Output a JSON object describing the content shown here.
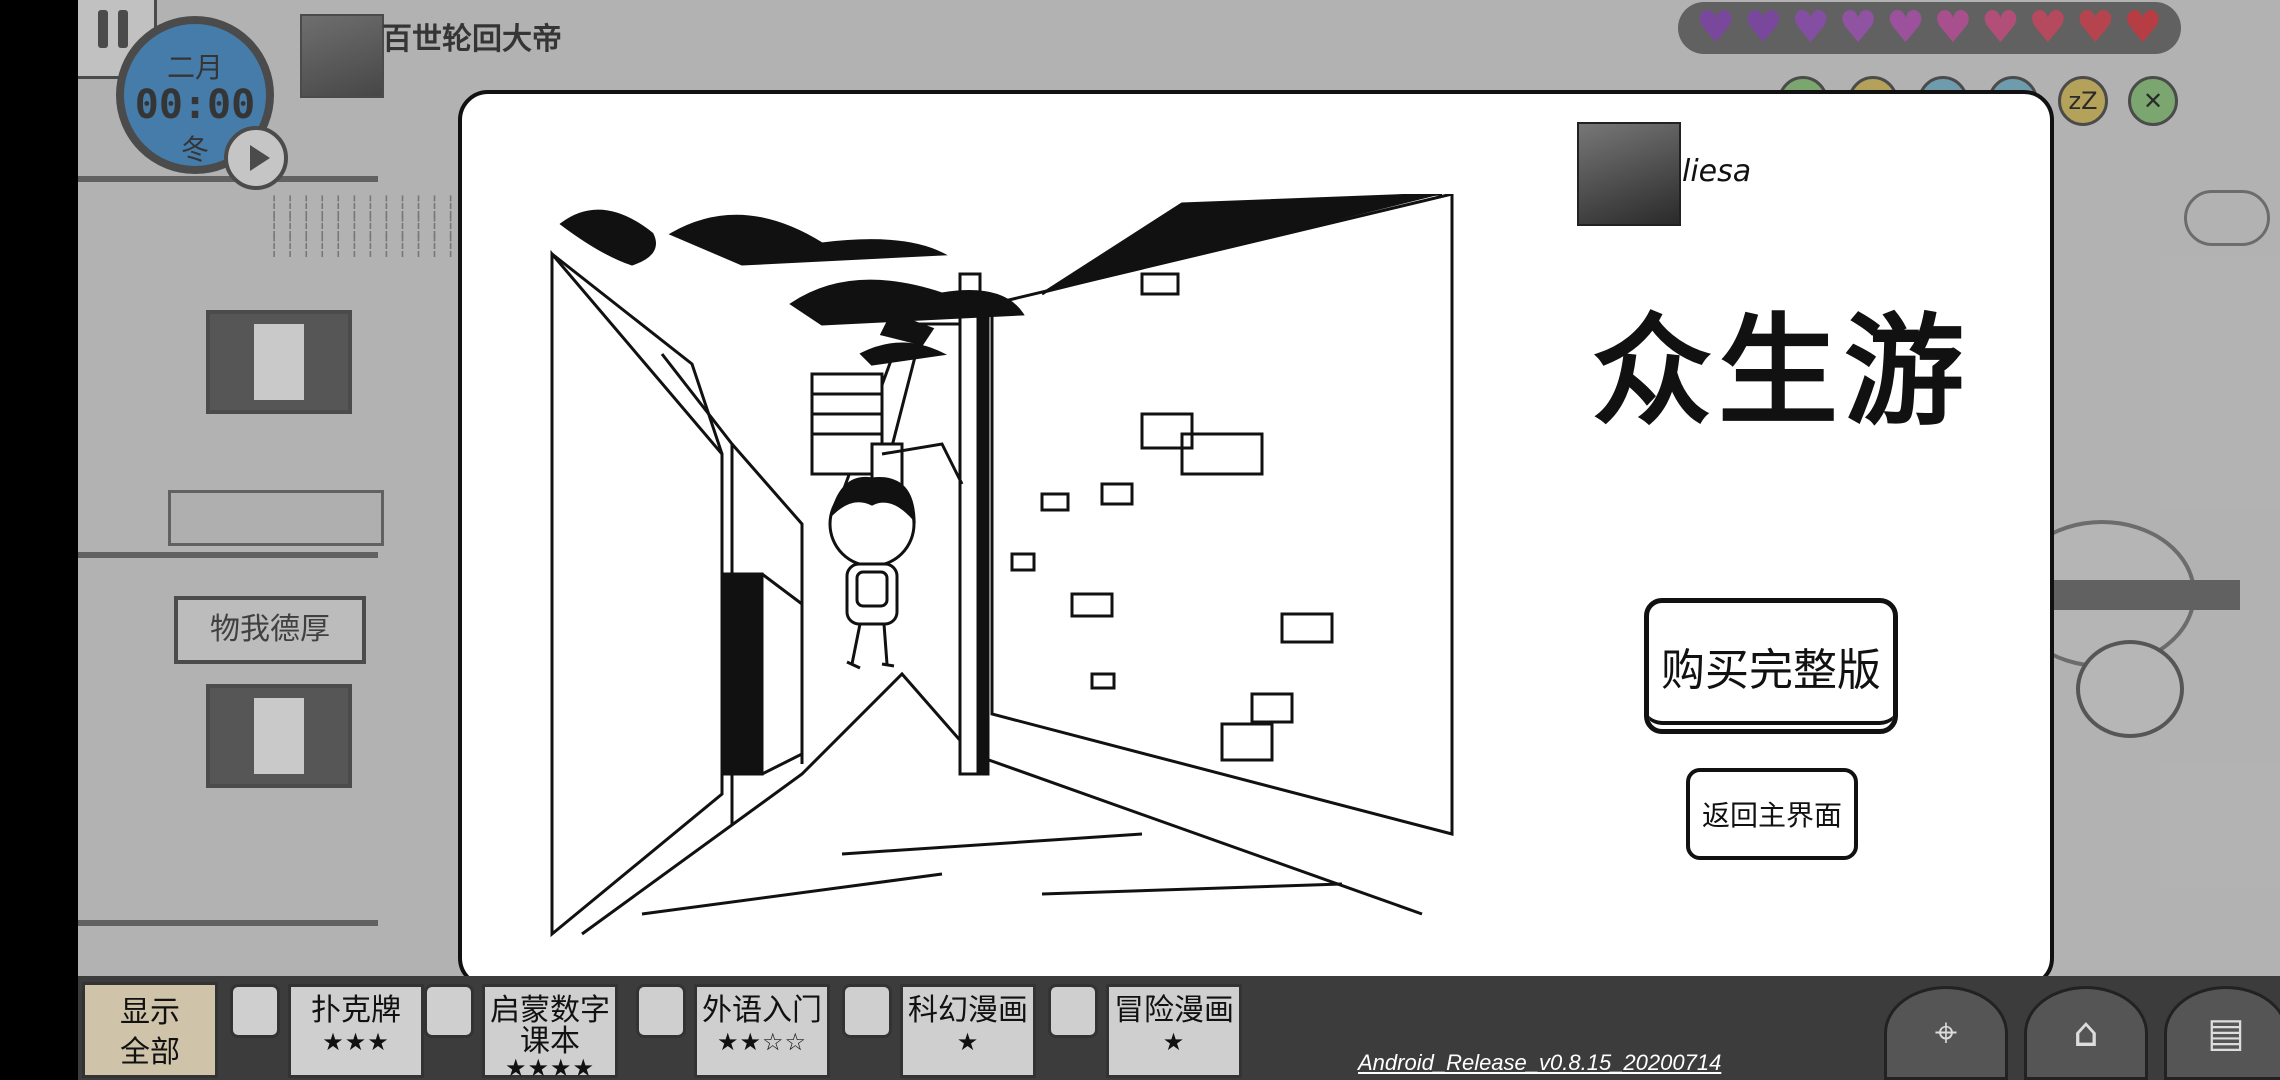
{
  "hud": {
    "month": "二月",
    "time": "00:00",
    "season": "冬",
    "player_name": "百世轮回大帝"
  },
  "hearts": {
    "count": 10,
    "colors": [
      "#7a2fb0",
      "#7a2fb0",
      "#8a3ab8",
      "#9b3fb8",
      "#b03cb0",
      "#c23a9a",
      "#d03a7a",
      "#d63050",
      "#d8283a",
      "#d81e28"
    ]
  },
  "stats": [
    {
      "icon": "leaf-icon",
      "glyph": "",
      "color": "#7fbf6a"
    },
    {
      "icon": "coin-icon",
      "glyph": "",
      "color": "#d6b94a"
    },
    {
      "icon": "water-icon",
      "glyph": "",
      "color": "#6ab0c8"
    },
    {
      "icon": "sparkle-icon",
      "glyph": "✦",
      "color": "#6ab0c8"
    },
    {
      "icon": "sleep-icon",
      "glyph": "zZ",
      "color": "#d6b94a"
    },
    {
      "icon": "food-icon",
      "glyph": "✕",
      "color": "#7fbf6a"
    }
  ],
  "scenery": {
    "signboard": "物我德厚"
  },
  "modal": {
    "author_name": "liesa",
    "game_title": "众生游",
    "buy_label": "购买完整版",
    "back_label": "返回主界面"
  },
  "bottom": {
    "show_all": "显示\n全部",
    "show_all_line1": "显示",
    "show_all_line2": "全部",
    "courses": [
      {
        "name": "扑克牌",
        "name2": "",
        "stars": "★★★"
      },
      {
        "name": "启蒙数字",
        "name2": "课本",
        "stars": "★★★★"
      },
      {
        "name": "外语入门",
        "name2": "",
        "stars": "★★☆☆"
      },
      {
        "name": "科幻漫画",
        "name2": "",
        "stars": "★"
      },
      {
        "name": "冒险漫画",
        "name2": "",
        "stars": "★"
      }
    ],
    "version": "Android_Release_v0.8.15_20200714"
  }
}
